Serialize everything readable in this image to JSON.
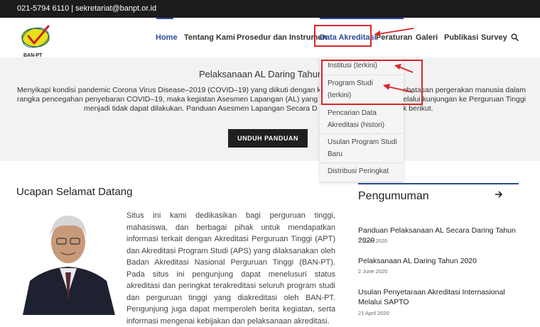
{
  "topbar": {
    "contact": "021-5794 6110 | sekretariat@banpt.or.id"
  },
  "header": {
    "logo_text": "BAN-PT",
    "nav": {
      "home": "Home",
      "tentang": "Tentang Kami",
      "prosedur": "Prosedur dan Instrumen",
      "data": "Data Akreditasi",
      "peraturan": "Peraturan",
      "galeri": "Galeri",
      "publikasi": "Publikasi",
      "survey": "Survey"
    },
    "search_icon": "search-icon"
  },
  "hero": {
    "title": "Pelaksanaan AL Daring Tahun 2",
    "text_line1": "Menyikapi kondisi pandemic Corona Virus Disease–2019 (COVID–19) yang diikuti dengan kebijakan",
    "text_line1b": "mbatasan pergerakan manusia dalam",
    "text_line2": "rangka pencegahan penyebaran COVID–19, maka kegiatan Asesmen Lapangan (AL) yang pada kea",
    "text_line2b": "melalui kunjungan ke Perguruan Tinggi",
    "text_line3": "menjadi tidak dapat dilakukan. Panduan Asesmen Lapangan Secara D",
    "text_line3b": "k berikut.",
    "button": "UNDUH PANDUAN"
  },
  "dropdown": {
    "items": [
      {
        "line1": "Institusi (terkini)",
        "line2": ""
      },
      {
        "line1": "Program Studi",
        "line2": "(terkini)"
      },
      {
        "line1": "Pencarian Data",
        "line2": "Akreditasi (histori)"
      },
      {
        "line1": "Usulan Program Studi",
        "line2": "Baru"
      },
      {
        "line1": "Distribusi Peringkat",
        "line2": ""
      }
    ]
  },
  "welcome": {
    "title": "Ucapan Selamat Datang",
    "text": "Situs ini kami dedikasikan bagi perguruan tinggi, mahasiswa, dan berbagai pihak untuk mendapatkan informasi terkait dengan Akreditasi Perguruan Tinggi (APT) dan Akreditasi Program Studi (APS) yang dilaksanakan oleh Badan Akreditasi Nasional Perguruan Tinggi (BAN-PT). Pada situs ini pengunjung dapat menelusuri status akreditasi dan peringkat terakreditasi seluruh program studi dan perguruan tinggi yang diakreditasi oleh BAN-PT. Pengunjung juga dapat memperoleh berita kegiatan, serta informasi mengenai kebijakan dan pelaksanaan akreditasi."
  },
  "announcements": {
    "title": "Pengumuman",
    "items": [
      {
        "title": "Panduan Pelaksanaan AL Secara Daring Tahun 2020",
        "date": "2 June 2020"
      },
      {
        "title": "Pelaksanaan AL Daring Tahun 2020",
        "date": "2 June 2020"
      },
      {
        "title": "Usulan Penyetaraan Akreditasi Internasional Melalui SAPTO",
        "date": "21 April 2020"
      }
    ]
  },
  "colors": {
    "accent": "#2c4a9a",
    "annotation": "#d9252a",
    "topbar": "#1c1c1c"
  }
}
